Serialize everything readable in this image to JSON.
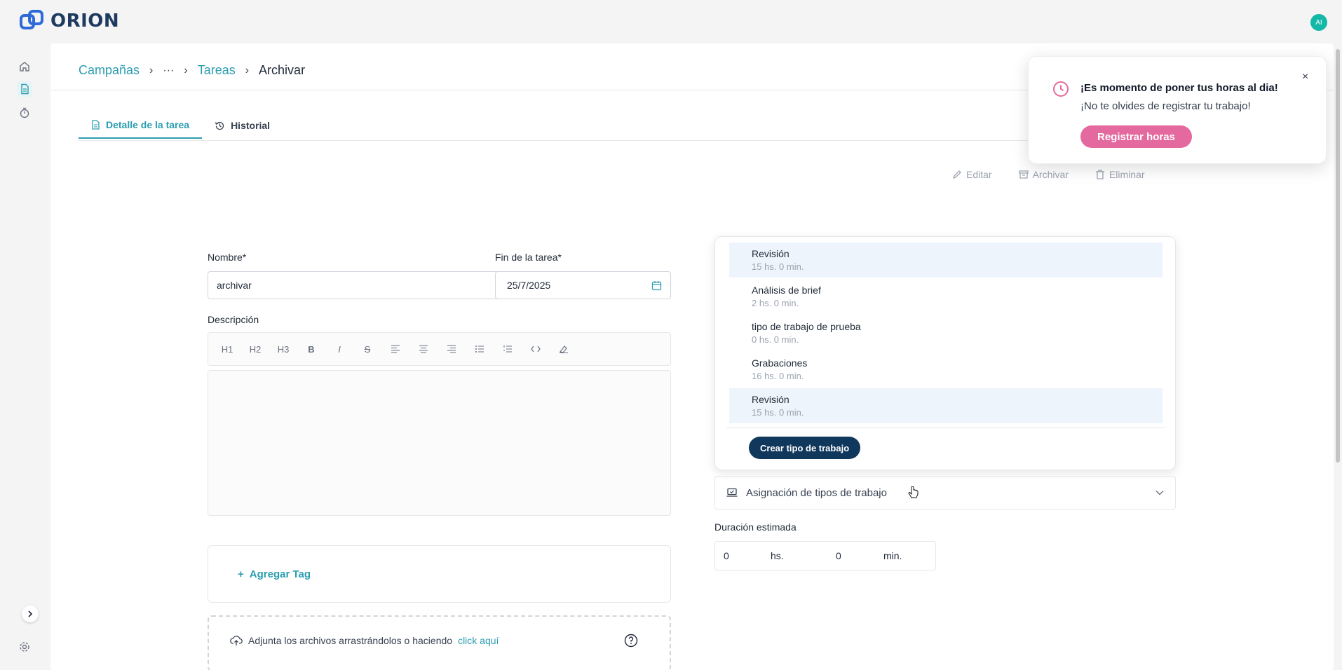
{
  "app": {
    "brand": "ORION",
    "avatar_initials": "AI"
  },
  "breadcrumb": {
    "campaigns": "Campañas",
    "ellipsis": "···",
    "tasks": "Tareas",
    "current": "Archivar"
  },
  "tabs": {
    "detail": "Detalle de la tarea",
    "history": "Historial"
  },
  "actions": {
    "edit": "Editar",
    "archive": "Archivar",
    "delete": "Eliminar"
  },
  "form": {
    "name_label": "Nombre*",
    "name_value": "archivar",
    "end_label": "Fin de la tarea*",
    "end_value": "25/7/2025",
    "description_label": "Descripción",
    "add_tag": "Agregar Tag",
    "upload_text": "Adjunta los archivos arrastrándolos o haciendo",
    "upload_link": "click aquí"
  },
  "toolbar": {
    "h1": "H1",
    "h2": "H2",
    "h3": "H3",
    "bold": "B",
    "italic": "I",
    "strike": "S"
  },
  "work_types": {
    "items": [
      {
        "name": "Revisión",
        "time": "15 hs. 0 min."
      },
      {
        "name": "Análisis de brief",
        "time": "2 hs. 0 min."
      },
      {
        "name": "tipo de trabajo de prueba",
        "time": "0 hs. 0 min."
      },
      {
        "name": "Grabaciones",
        "time": "16 hs. 0 min."
      },
      {
        "name": "Revisión",
        "time": "15 hs. 0 min."
      }
    ],
    "create_button": "Crear tipo de trabajo",
    "assign_label": "Asignación de tipos de trabajo"
  },
  "duration": {
    "label": "Duración estimada",
    "hours": "0",
    "hours_unit": "hs.",
    "minutes": "0",
    "minutes_unit": "min."
  },
  "toast": {
    "title": "¡Es momento de poner tus horas al dia!",
    "message": "¡No te olvides de registrar tu trabajo!",
    "button": "Registrar horas",
    "close": "×"
  },
  "colors": {
    "accent": "#2a9db0",
    "primary_dark": "#10375c",
    "toast_pink": "#e4699e"
  }
}
